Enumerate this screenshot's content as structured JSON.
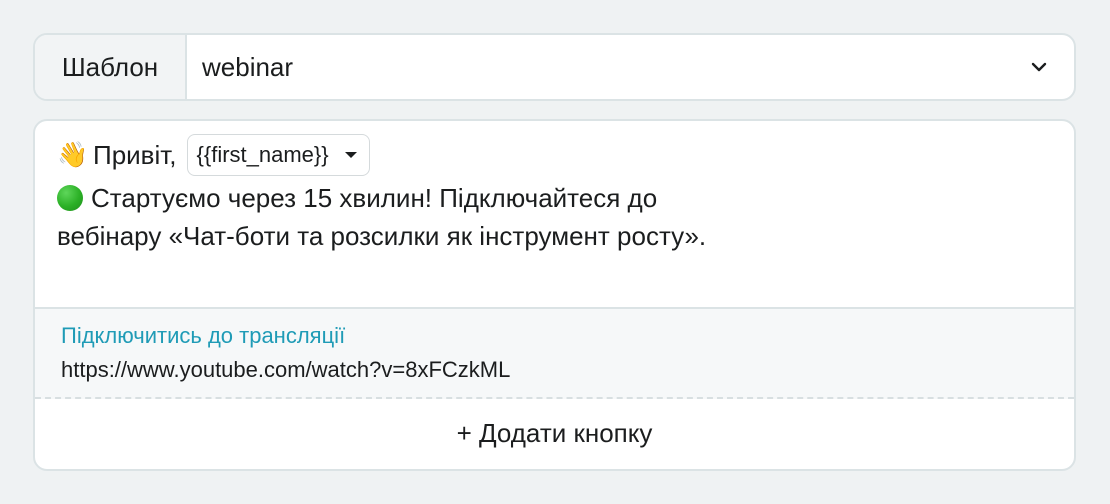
{
  "template": {
    "label": "Шаблон",
    "selected": "webinar"
  },
  "message": {
    "greeting_emoji": "👋",
    "greeting": "Привіт,",
    "variable": "{{first_name}}",
    "line1": "Стартуємо через 15 хвилин! Підключайтеся до",
    "line2": "вебінару «Чат-боти та розсилки як інструмент росту».",
    "status_color": "#2bb026"
  },
  "inline_button": {
    "title": "Підключитись до трансляції",
    "url": "https://www.youtube.com/watch?v=8xFCzkML",
    "title_color": "#1f9bb6"
  },
  "add_button": {
    "label": "+ Додати кнопку"
  }
}
